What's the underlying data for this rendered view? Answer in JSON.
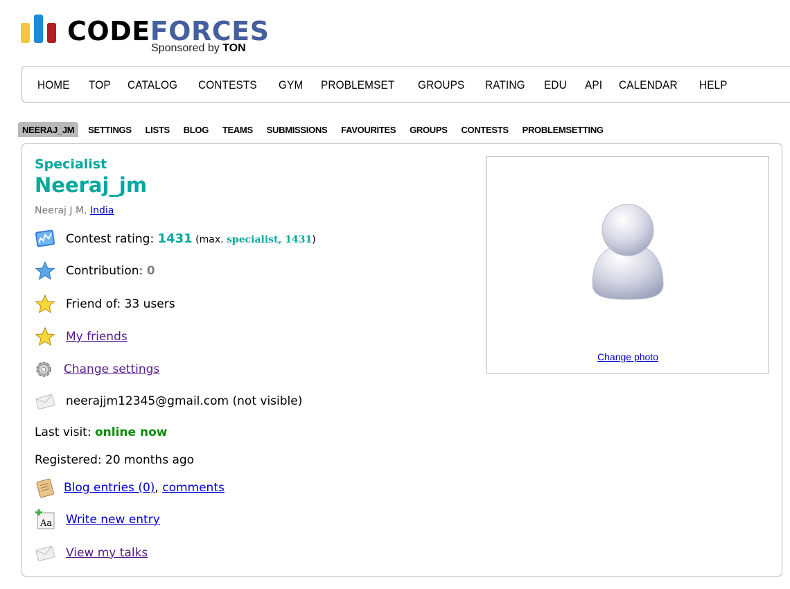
{
  "logo": {
    "code": "CODE",
    "forces": "FORCES",
    "sponsor_prefix": "Sponsored by ",
    "sponsor_name": "TON",
    "bar_colors": [
      "#f6c43d",
      "#1a8cd8",
      "#b11e26"
    ]
  },
  "main_menu": [
    "HOME",
    "TOP",
    "CATALOG",
    "CONTESTS",
    "GYM",
    "PROBLEMSET",
    "GROUPS",
    "RATING",
    "EDU",
    "API",
    "CALENDAR",
    "HELP"
  ],
  "second_menu": [
    "NEERAJ_JM",
    "SETTINGS",
    "LISTS",
    "BLOG",
    "TEAMS",
    "SUBMISSIONS",
    "FAVOURITES",
    "GROUPS",
    "CONTESTS",
    "PROBLEMSETTING"
  ],
  "profile": {
    "rank": "Specialist",
    "handle": "Neeraj_jm",
    "real_name": "Neeraj J M, ",
    "country": "India",
    "rating_label": "Contest rating: ",
    "rating": "1431",
    "max_open": " (max. ",
    "max_rank": "specialist, 1431",
    "max_close": ")",
    "contribution_label": "Contribution: ",
    "contribution": "0",
    "friend_of": "Friend of: 33 users",
    "my_friends": "My friends",
    "change_settings": "Change settings",
    "email": "neerajjm12345@gmail.com (not visible)",
    "last_visit_label": "Last visit: ",
    "last_visit": "online now",
    "registered": "Registered: 20 months ago",
    "blog_entries": "Blog entries (0)",
    "comma": ", ",
    "comments": "comments",
    "write_new_entry": "Write new entry",
    "view_my_talks": "View my talks",
    "change_photo": "Change photo"
  },
  "colors": {
    "specialist": "#03a89e",
    "online": "#0a8a0a",
    "border": "#b9b9b9"
  }
}
